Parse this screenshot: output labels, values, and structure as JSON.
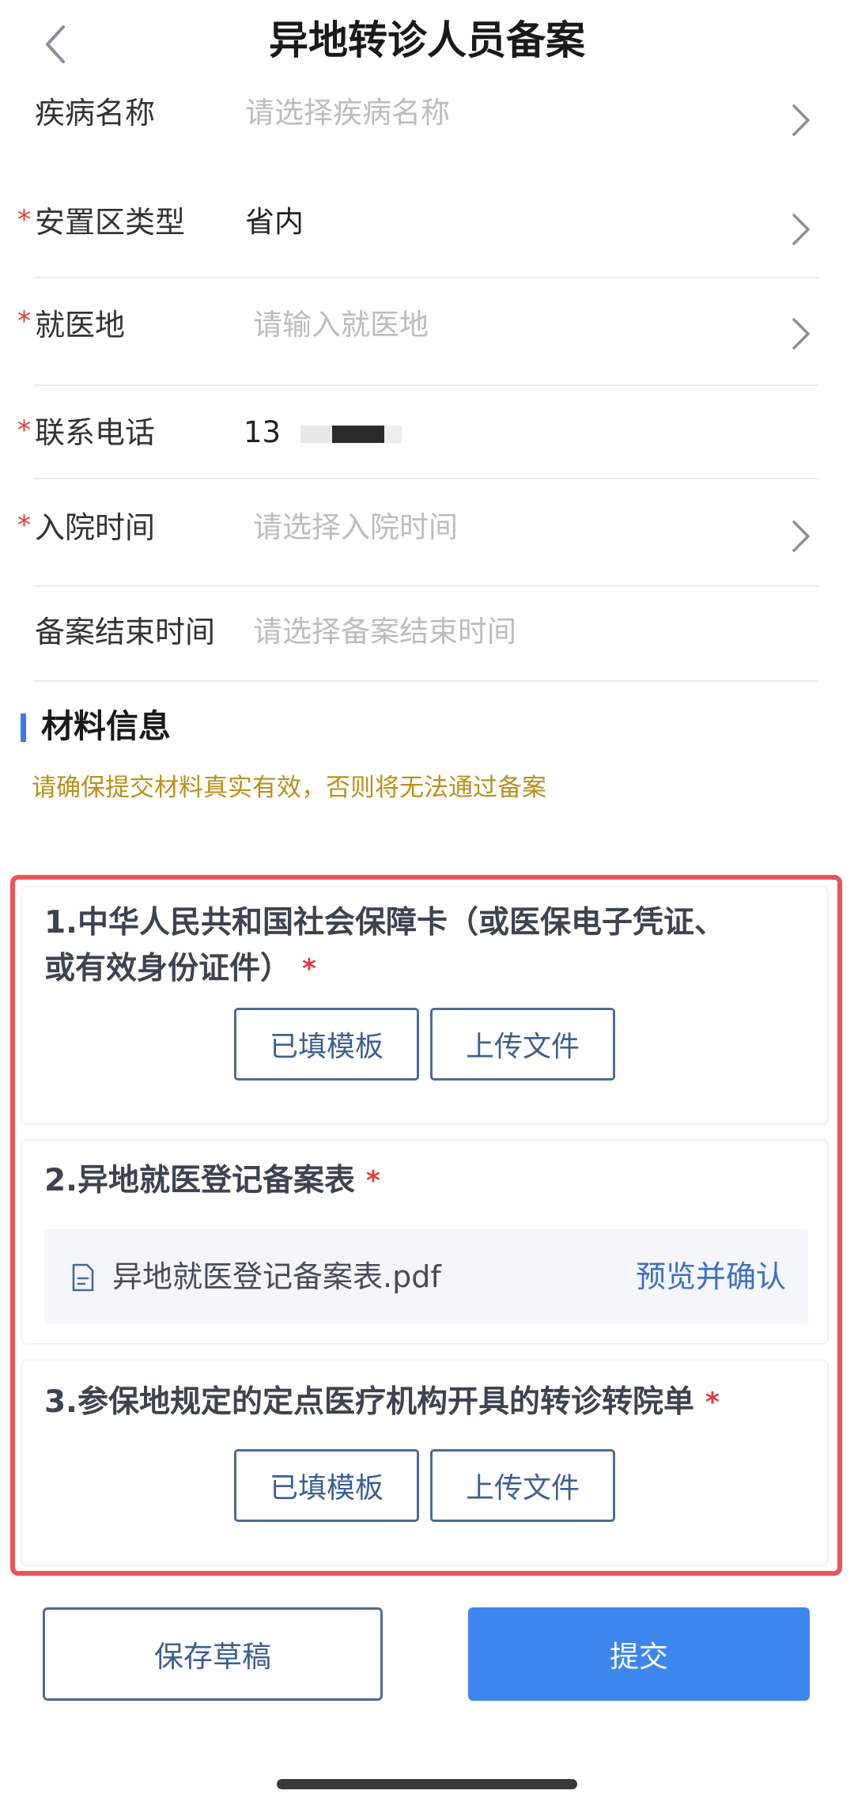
{
  "header": {
    "title": "异地转诊人员备案",
    "back_icon": "chevron-left-icon"
  },
  "form": {
    "rows": [
      {
        "label": "疾病名称",
        "value": "请选择疾病名称",
        "required": false,
        "is_placeholder": true,
        "has_chevron": true
      },
      {
        "label": "安置区类型",
        "value": "省内",
        "required": true,
        "is_placeholder": false,
        "has_chevron": true
      },
      {
        "label": "就医地",
        "value": "请输入就医地",
        "required": true,
        "is_placeholder": true,
        "has_chevron": true
      },
      {
        "label": "联系电话",
        "value": "13",
        "required": true,
        "is_placeholder": false,
        "has_chevron": false,
        "masked": true
      },
      {
        "label": "入院时间",
        "value": "请选择入院时间",
        "required": true,
        "is_placeholder": true,
        "has_chevron": true
      },
      {
        "label": "备案结束时间",
        "value": "请选择备案结束时间",
        "required": false,
        "is_placeholder": true,
        "has_chevron": false
      }
    ],
    "required_mark": "*",
    "chevron_icon": "chevron-right-icon"
  },
  "materials": {
    "section_title": "材料信息",
    "notice": "请确保提交材料真实有效，否则将无法通过备案",
    "items": [
      {
        "title_line1": "1.中华人民共和国社会保障卡（或医保电子凭证、",
        "title_line2": "或有效身份证件）",
        "required_mark": "*",
        "template_label": "已填模板",
        "upload_label": "上传文件"
      },
      {
        "title": "2.异地就医登记备案表",
        "required_mark": "*",
        "file_name": "异地就医登记备案表.pdf",
        "file_action": "预览并确认",
        "file_icon": "document-icon"
      },
      {
        "title": "3.参保地规定的定点医疗机构开具的转诊转院单",
        "required_mark": "*",
        "template_label": "已填模板",
        "upload_label": "上传文件"
      }
    ]
  },
  "footer": {
    "draft_label": "保存草稿",
    "submit_label": "提交"
  },
  "colors": {
    "accent": "#3d86ed",
    "required": "#e23a3a",
    "notice": "#b99019",
    "highlight": "#e9545b",
    "outline_button": "#4d6b94"
  }
}
